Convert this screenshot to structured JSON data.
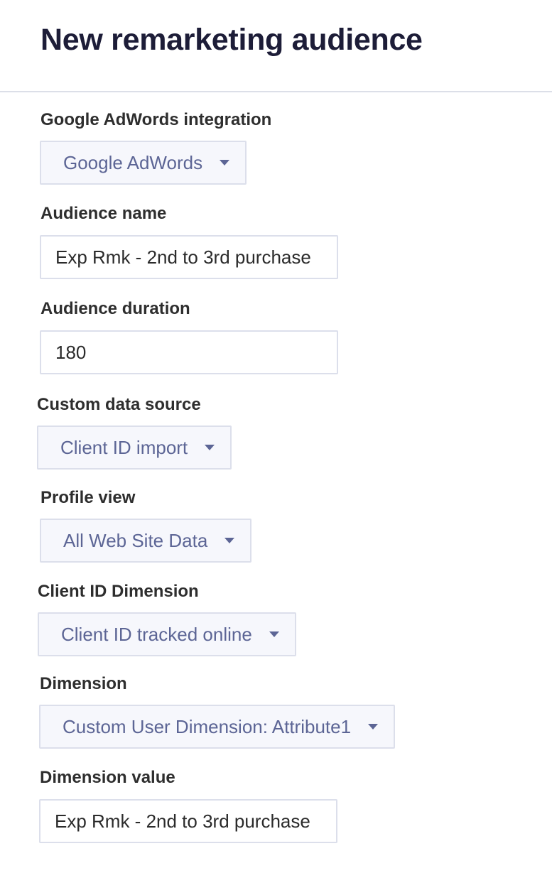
{
  "header": {
    "title": "New remarketing audience"
  },
  "fields": {
    "integration": {
      "label": "Google AdWords integration",
      "value": "Google AdWords"
    },
    "audience_name": {
      "label": "Audience name",
      "value": "Exp Rmk - 2nd to 3rd purchase"
    },
    "audience_duration": {
      "label": "Audience duration",
      "value": "180"
    },
    "data_source": {
      "label": "Custom data source",
      "value": "Client ID import"
    },
    "profile_view": {
      "label": "Profile view",
      "value": "All Web Site Data"
    },
    "client_id_dimension": {
      "label": "Client ID Dimension",
      "value": "Client ID tracked online"
    },
    "dimension": {
      "label": "Dimension",
      "value": "Custom User Dimension: Attribute1"
    },
    "dimension_value": {
      "label": "Dimension value",
      "value": "Exp Rmk - 2nd to 3rd purchase"
    }
  },
  "icons": {
    "dropdown": "chevron-down-icon"
  },
  "colors": {
    "title": "#1d1d38",
    "dropdown_text": "#5c6595",
    "dropdown_bg": "#f6f7fc",
    "border": "#dcdfeb"
  }
}
